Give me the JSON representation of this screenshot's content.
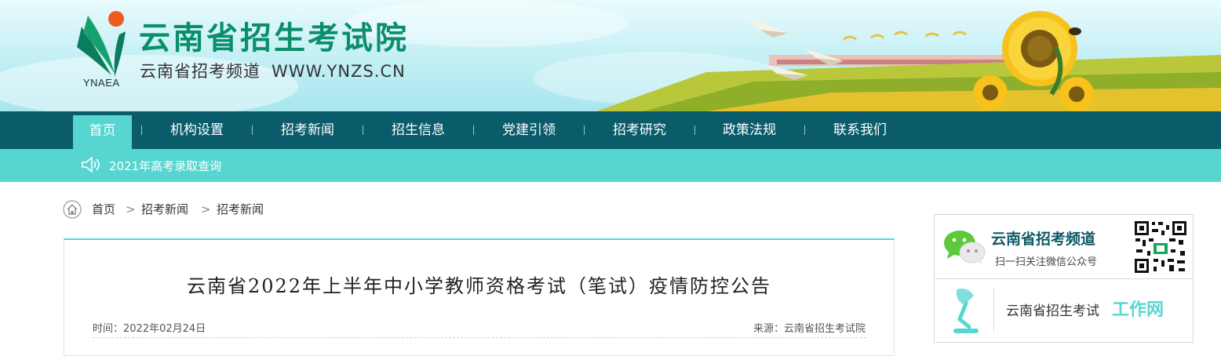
{
  "header": {
    "site_title": "云南省招生考试院",
    "site_subtitle": "云南省招考频道",
    "site_url": "WWW.YNZS.CN",
    "logo_abbr": "YNAEA"
  },
  "nav": {
    "items": [
      {
        "label": "首页",
        "active": true
      },
      {
        "label": "机构设置"
      },
      {
        "label": "招考新闻"
      },
      {
        "label": "招生信息"
      },
      {
        "label": "党建引领"
      },
      {
        "label": "招考研究"
      },
      {
        "label": "政策法规"
      },
      {
        "label": "联系我们"
      }
    ]
  },
  "notice": {
    "icon": "speaker-icon",
    "link_text": "2021年高考录取查询"
  },
  "breadcrumb": {
    "icon": "home-icon",
    "items": [
      "首页",
      "招考新闻",
      "招考新闻"
    ],
    "separator": ">"
  },
  "article": {
    "title": "云南省2022年上半年中小学教师资格考试（笔试）疫情防控公告",
    "time": "时间：2022年02月24日",
    "source": "来源：云南省招生考试院"
  },
  "sidebar": {
    "wechat": {
      "icon": "wechat-icon",
      "title": "云南省招考频道",
      "subtitle": "扫一扫关注微信公众号",
      "qr_icon": "qr-code-icon"
    },
    "work": {
      "icon": "lamp-icon",
      "text_a": "云南省招生考试",
      "text_b": "工作网"
    }
  },
  "colors": {
    "nav_bg": "#0b5c6b",
    "accent": "#57d6d1",
    "brand_green": "#0b8f6a"
  }
}
